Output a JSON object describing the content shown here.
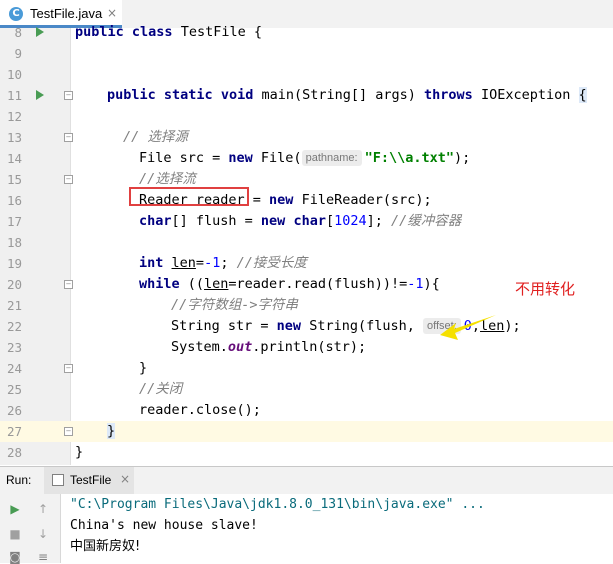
{
  "tab": {
    "icon_letter": "C",
    "label": "TestFile.java",
    "close": "×"
  },
  "annotation": "不用转化",
  "lines": [
    {
      "n": "8"
    },
    {
      "n": "9"
    },
    {
      "n": "10"
    },
    {
      "n": "11"
    },
    {
      "n": "12"
    },
    {
      "n": "13"
    },
    {
      "n": "14"
    },
    {
      "n": "15"
    },
    {
      "n": "16"
    },
    {
      "n": "17"
    },
    {
      "n": "18"
    },
    {
      "n": "19"
    },
    {
      "n": "20"
    },
    {
      "n": "21"
    },
    {
      "n": "22"
    },
    {
      "n": "23"
    },
    {
      "n": "24"
    },
    {
      "n": "25"
    },
    {
      "n": "26"
    },
    {
      "n": "27"
    },
    {
      "n": "28"
    }
  ],
  "code": {
    "l8": {
      "kw1": "public",
      "kw2": "class",
      "rest": " TestFile {"
    },
    "l11": {
      "kw1": "public",
      "kw2": "static",
      "kw3": "void",
      "mid": " main(String[] args) ",
      "kw4": "throws",
      "rest": " IOException ",
      "brace": "{"
    },
    "l13": {
      "comment": "// 选择源"
    },
    "l14": {
      "a": "File src = ",
      "kw": "new",
      "b": " File(",
      "hint": "pathname:",
      "str": "\"F:\\\\a.txt\"",
      "c": ");"
    },
    "l15": {
      "comment": "//选择流"
    },
    "l16": {
      "a": "Reader reader = ",
      "kw": "new",
      "b": " FileReader(src);"
    },
    "l17": {
      "kw1": "char",
      "a": "[] flush = ",
      "kw2": "new",
      "b": " ",
      "kw3": "char",
      "c": "[",
      "num": "1024",
      "d": "]; ",
      "comment": "//缓冲容器"
    },
    "l19": {
      "kw": "int",
      "a": " ",
      "var": "len",
      "b": "=",
      "num": "-1",
      "c": "; ",
      "comment": "//接受长度"
    },
    "l20": {
      "kw": "while",
      "a": " ((",
      "var": "len",
      "b": "=reader.read(flush))!=",
      "num": "-1",
      "c": "){"
    },
    "l21": {
      "comment": "//字符数组->字符串"
    },
    "l22": {
      "a": "String str = ",
      "kw": "new",
      "b": " String(flush, ",
      "hint": "offset:",
      "num": "0",
      "c": ",",
      "var": "len",
      "d": ");"
    },
    "l23": {
      "a": "System.",
      "fld": "out",
      "b": ".println(str);"
    },
    "l24": {
      "a": "}"
    },
    "l25": {
      "comment": "//关闭"
    },
    "l26": {
      "a": "reader.close();"
    },
    "l27": {
      "a": "}"
    },
    "l28": {
      "a": "}"
    }
  },
  "run": {
    "label": "Run:",
    "tab_label": "TestFile",
    "tab_close": "×",
    "tools": {
      "play": "▶",
      "up": "↑",
      "stop": "■",
      "down": "↓",
      "camera": "◙",
      "lines": "≡"
    },
    "console": [
      "\"C:\\Program Files\\Java\\jdk1.8.0_131\\bin\\java.exe\" ...",
      "China's new house slave!",
      "中国新房奴!"
    ]
  },
  "colors": {
    "keyword": "#000080",
    "string": "#008000",
    "number": "#0000ff",
    "comment": "#808080",
    "annotation": "#e02020",
    "arrow": "#f5e000",
    "run_icon": "#499c54",
    "cmd_line": "#0a6b7b"
  }
}
